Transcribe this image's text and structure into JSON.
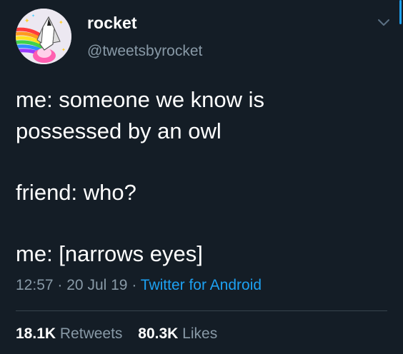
{
  "user": {
    "display_name": "rocket",
    "handle": "@tweetsbyrocket",
    "avatar_icon": "rocket-avatar"
  },
  "tweet": {
    "lines": [
      "me: someone we know is",
      "possessed by an owl",
      "",
      "friend: who?",
      "",
      "me: [narrows eyes]"
    ]
  },
  "meta": {
    "time": "12:57",
    "separator": "·",
    "date": "20 Jul 19",
    "source": "Twitter for Android"
  },
  "stats": {
    "retweets_count": "18.1K",
    "retweets_label": "Retweets",
    "likes_count": "80.3K",
    "likes_label": "Likes"
  },
  "colors": {
    "background": "#141d26",
    "secondary_text": "#8899a6",
    "accent": "#1da1f2",
    "divider": "#38444d"
  }
}
